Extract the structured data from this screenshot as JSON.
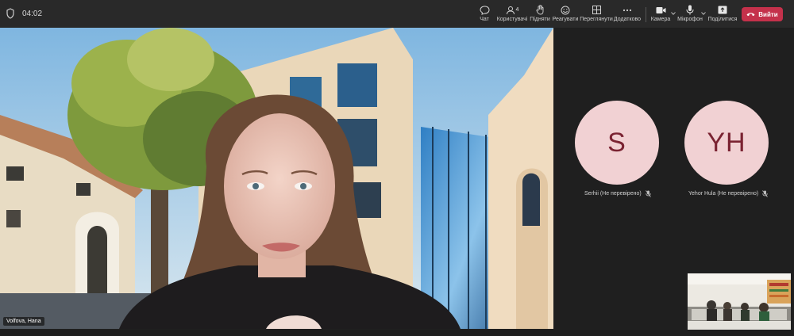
{
  "meeting": {
    "timer": "04:02"
  },
  "toolbar": {
    "chat_label": "Чат",
    "people_label": "Користувачі",
    "people_count": "4",
    "raise_label": "Підняти",
    "react_label": "Реагувати",
    "view_label": "Переглянути",
    "more_label": "Додатково",
    "camera_label": "Камера",
    "mic_label": "Мікрофон",
    "share_label": "Поділитися",
    "leave_label": "Вийти"
  },
  "main_video": {
    "participant_name": "Volfova, Hana"
  },
  "participants": [
    {
      "initials": "S",
      "name": "Serhii (Не перевірено)",
      "avatar_bg": "#f1d1d3",
      "initials_color": "#7a2332"
    },
    {
      "initials": "YH",
      "name": "Yehor Hula (Не перевірено)",
      "avatar_bg": "#f1d1d3",
      "initials_color": "#7a2332"
    }
  ],
  "colors": {
    "leave_button": "#c4314b",
    "topbar": "#292929",
    "stage": "#1f1f1f"
  },
  "icons": {
    "chat": "chat-icon",
    "people": "people-icon",
    "raise": "hand-icon",
    "react": "smiley-icon",
    "view": "grid-icon",
    "more": "ellipsis-icon",
    "camera": "camera-icon",
    "mic": "microphone-icon",
    "share": "share-icon",
    "leave": "phone-hangup-icon"
  }
}
